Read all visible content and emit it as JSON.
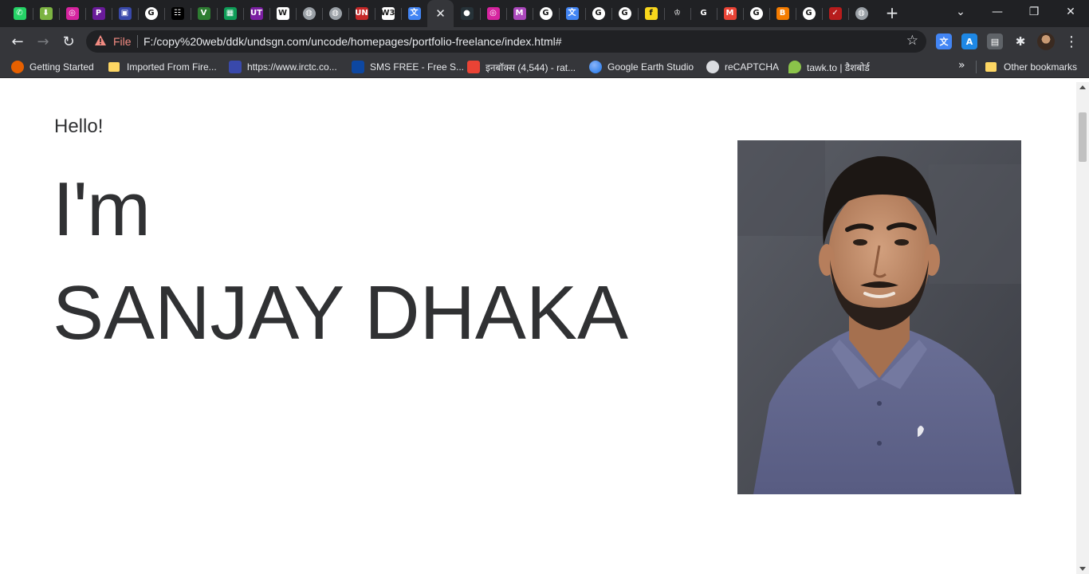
{
  "browser": {
    "tabs": [
      {
        "icon": "whatsapp-icon",
        "glyph": "✆",
        "color": "#25d366"
      },
      {
        "icon": "download-icon",
        "glyph": "⬇",
        "color": "#7cb342"
      },
      {
        "icon": "instagram-icon",
        "glyph": "◎",
        "color": "#d6249f"
      },
      {
        "icon": "p-app-icon",
        "glyph": "P",
        "color": "#6a1b9a"
      },
      {
        "icon": "irctc-icon",
        "glyph": "▣",
        "color": "#3949ab"
      },
      {
        "icon": "google-icon",
        "glyph": "G",
        "color": "#ffffff"
      },
      {
        "icon": "bookmark-x-icon",
        "glyph": "☷",
        "color": "#000000"
      },
      {
        "icon": "v-app-icon",
        "glyph": "V",
        "color": "#2e7d32"
      },
      {
        "icon": "sheets-icon",
        "glyph": "▦",
        "color": "#0f9d58"
      },
      {
        "icon": "ut-icon",
        "glyph": "UT",
        "color": "#7b1fa2"
      },
      {
        "icon": "wikipedia-icon",
        "glyph": "W",
        "color": "#ffffff"
      },
      {
        "icon": "globe-icon",
        "glyph": "◍",
        "color": "#9aa0a6"
      },
      {
        "icon": "globe-icon",
        "glyph": "◍",
        "color": "#9aa0a6"
      },
      {
        "icon": "un-icon",
        "glyph": "UN",
        "color": "#c62828"
      },
      {
        "icon": "w3schools-icon",
        "glyph": "W3",
        "color": "#ffffff"
      },
      {
        "icon": "translate-icon",
        "glyph": "文",
        "color": "#4285f4"
      },
      {
        "icon": "close-icon",
        "glyph": "✕",
        "color": "",
        "active": true
      },
      {
        "icon": "circle-dot-icon",
        "glyph": "●",
        "color": "#263238"
      },
      {
        "icon": "instagram-icon",
        "glyph": "◎",
        "color": "#d6249f"
      },
      {
        "icon": "m-app-icon",
        "glyph": "M",
        "color": "#ab47bc"
      },
      {
        "icon": "google-icon",
        "glyph": "G",
        "color": "#ffffff"
      },
      {
        "icon": "translate-icon",
        "glyph": "文",
        "color": "#4285f4"
      },
      {
        "icon": "google-icon",
        "glyph": "G",
        "color": "#ffffff"
      },
      {
        "icon": "google-icon",
        "glyph": "G",
        "color": "#ffffff"
      },
      {
        "icon": "flipkart-icon",
        "glyph": "f",
        "color": "#f9d71c"
      },
      {
        "icon": "chess-icon",
        "glyph": "♔",
        "color": "#202124"
      },
      {
        "icon": "google-small-icon",
        "glyph": "G",
        "color": "#202124"
      },
      {
        "icon": "gmail-icon",
        "glyph": "M",
        "color": "#ea4335"
      },
      {
        "icon": "google-icon",
        "glyph": "G",
        "color": "#ffffff"
      },
      {
        "icon": "blogger-icon",
        "glyph": "B",
        "color": "#f57c00"
      },
      {
        "icon": "google-icon",
        "glyph": "G",
        "color": "#ffffff"
      },
      {
        "icon": "check-icon",
        "glyph": "✓",
        "color": "#b71c1c"
      },
      {
        "icon": "globe-icon",
        "glyph": "◍",
        "color": "#9aa0a6"
      }
    ],
    "new_tab_glyph": "+",
    "window_controls": {
      "tab_search": "⌄",
      "minimize": "—",
      "restore": "❐",
      "close": "✕"
    },
    "toolbar": {
      "back": "←",
      "forward": "→",
      "reload": "↻",
      "security_label": "File",
      "url": "F:/copy%20web/ddk/undsgn.com/uncode/homepages/portfolio-freelance/index.html#",
      "star": "☆",
      "menu": "⋮",
      "extensions": [
        {
          "icon": "translate-extension-icon",
          "glyph": "文",
          "color": "#4285f4"
        },
        {
          "icon": "text-extension-icon",
          "glyph": "A",
          "color": "#1e88e5"
        },
        {
          "icon": "printer-extension-icon",
          "glyph": "▤",
          "color": "#5f6368"
        },
        {
          "icon": "puzzle-icon",
          "glyph": "✱",
          "color": ""
        }
      ]
    },
    "bookmarks": [
      {
        "label": "Getting Started",
        "icon": "firefox-icon",
        "color": "#e66000"
      },
      {
        "label": "Imported From Fire...",
        "icon": "folder-icon",
        "color": "#fdd663"
      },
      {
        "label": "https://www.irctc.co...",
        "icon": "irctc-icon",
        "color": "#3949ab"
      },
      {
        "label": "SMS FREE - Free S...",
        "icon": "sms-icon",
        "color": "#0d47a1"
      },
      {
        "label": "इनबॉक्स (4,544) - rat...",
        "icon": "gmail-icon",
        "color": "#ea4335"
      },
      {
        "label": "Google Earth Studio",
        "icon": "earth-icon",
        "color": "#4285f4"
      },
      {
        "label": "reCAPTCHA",
        "icon": "globe-icon",
        "color": "#9aa0a6"
      },
      {
        "label": "tawk.to | डैशबोर्ड",
        "icon": "tawk-icon",
        "color": "#8bc34a"
      }
    ],
    "more_bookmarks": "»",
    "other_bookmarks": "Other bookmarks"
  },
  "page": {
    "greeting": "Hello!",
    "intro": "I'm",
    "name": "SANJAY DHAKA"
  }
}
